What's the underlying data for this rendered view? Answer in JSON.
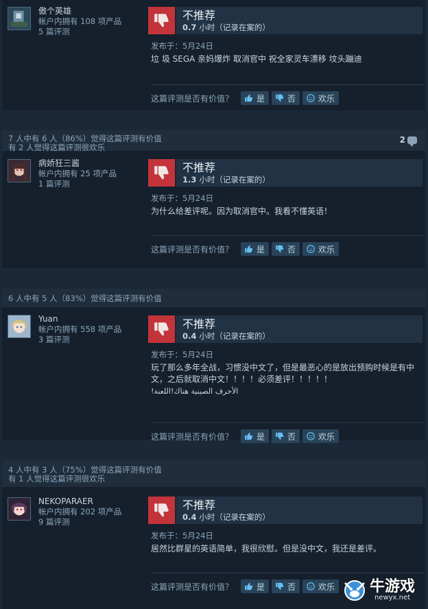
{
  "common": {
    "verdict_title": "不推荐",
    "hours_unit": "小时（记录在案的）",
    "posted_prefix": "发布于：",
    "helpful_prompt": "这篇评测是否有价值？",
    "yes_label": "是",
    "no_label": "否",
    "funny_label": "欢乐"
  },
  "reviews": [
    {
      "author_name": "傲个英雄",
      "products": "帐户内拥有 108 项产品",
      "review_count": "5 篇评测",
      "hours": "0.7",
      "posted_date": "5月24日",
      "text": "垃 圾 SEGA 亲妈爆炸 取消官中 祝全家灵车漂移 坟头蹦迪"
    },
    {
      "header_line1": "7 人中有 6 人（86%）觉得这篇评测有价值",
      "header_line2": "有 2 人觉得这篇评测很欢乐",
      "comment_count": "2",
      "author_name": "病娇狂三酱",
      "products": "帐户内拥有 25 项产品",
      "review_count": "1 篇评测",
      "hours": "1.3",
      "posted_date": "5月24日",
      "text": "为什么给差评呢。因为取消官中。我看不懂英语！"
    },
    {
      "header_line1": "6 人中有 5 人（83%）觉得这篇评测有价值",
      "author_name": "Yuan",
      "products": "帐户内拥有 558 项产品",
      "review_count": "3 篇评测",
      "hours": "0.4",
      "posted_date": "5月24日",
      "text": "玩了那么多年全战，习惯没中文了，但是最恶心的是放出预购时候是有中文，之后就取消中文！！！！必须差评！！！！！",
      "text2": "!الأحرف الصينية هناك!اللعنة"
    },
    {
      "header_line1": "4 人中有 3 人（75%）觉得这篇评测有价值",
      "header_line2": "有 1 人觉得这篇评测很欢乐",
      "author_name": "NEKOPARAER",
      "products": "帐户内拥有 202 项产品",
      "review_count": "9 篇评测",
      "hours": "0.4",
      "posted_date": "5月24日",
      "text": "居然比群星的英语简单，我很欣慰。但是没中文，我还是差评。"
    }
  ],
  "watermark": {
    "brand": "牛游戏",
    "url": "newyx.net"
  },
  "colors": {
    "background": "#1b2838",
    "thumb_down": "#c2343a",
    "vote_button": "#294359"
  }
}
